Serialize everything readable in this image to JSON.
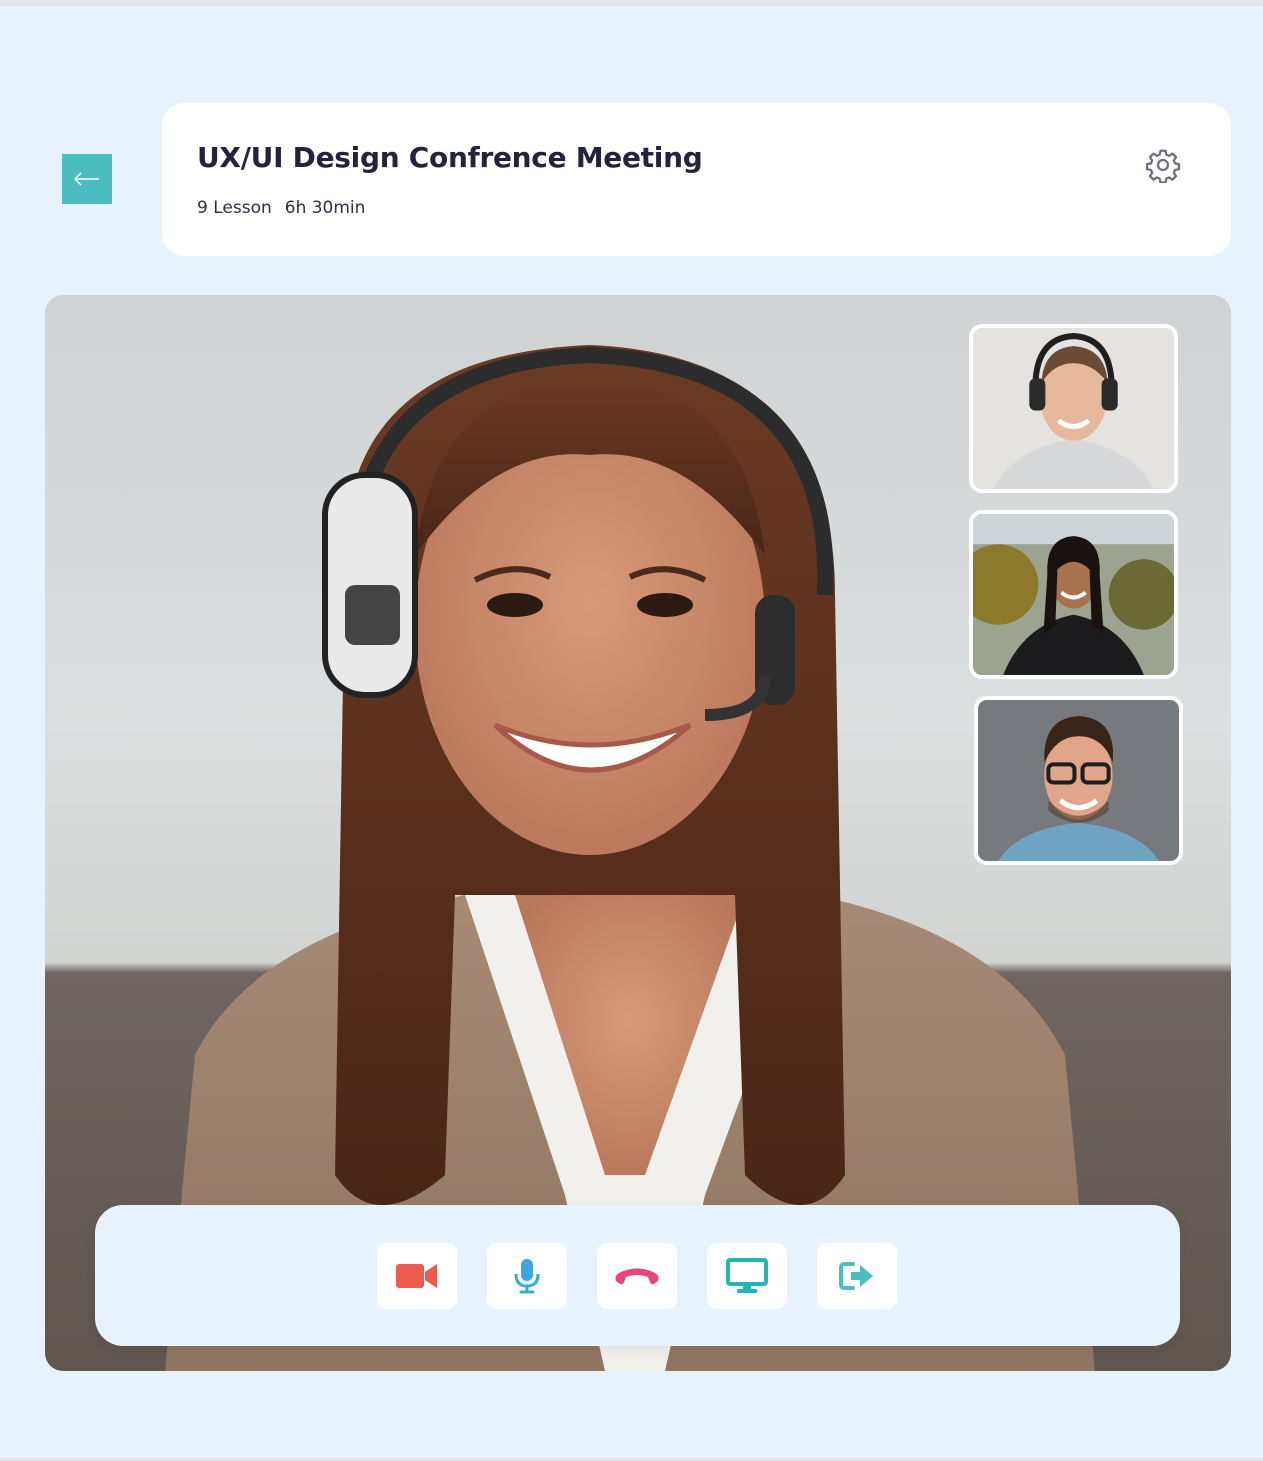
{
  "header": {
    "title": "UX/UI Design Confrence Meeting",
    "lessons": "9 Lesson",
    "duration": "6h 30min"
  },
  "icons": {
    "back": "arrow-left-icon",
    "settings": "gear-icon",
    "camera": "video-camera-icon",
    "mic": "microphone-icon",
    "hangup": "phone-hangup-icon",
    "screen": "monitor-icon",
    "leave": "exit-icon"
  },
  "participants": [
    {
      "id": "main-speaker",
      "description_visual": "woman-with-headset"
    },
    {
      "id": "participant-1",
      "description_visual": "woman-with-headphones"
    },
    {
      "id": "participant-2",
      "description_visual": "woman-outdoors"
    },
    {
      "id": "participant-3",
      "description_visual": "man-with-glasses"
    }
  ],
  "colors": {
    "accent": "#4bbdc0",
    "camera": "#ef5a4e",
    "mic": "#3aa8e0",
    "hangup": "#e8457a",
    "screen": "#1fb8b0",
    "leave": "#4bbdc0",
    "background": "#e8f2fc"
  }
}
